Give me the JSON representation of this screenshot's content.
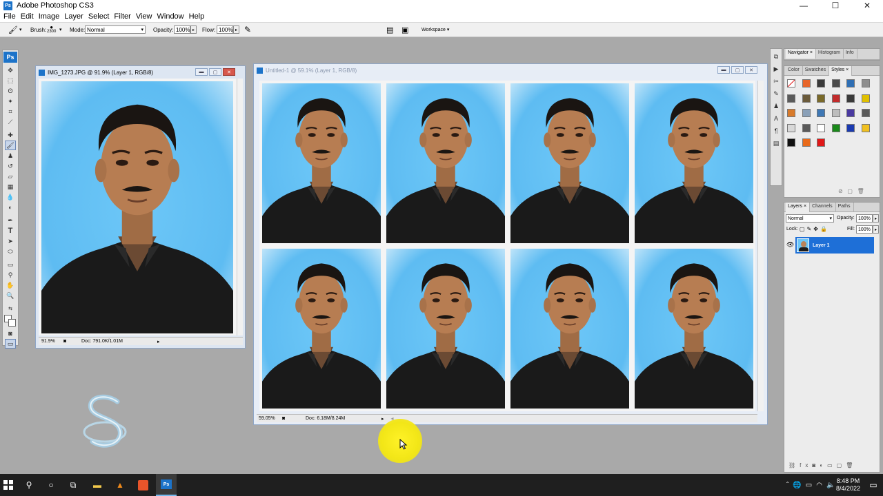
{
  "app": {
    "title": "Adobe Photoshop CS3",
    "logo": "Ps"
  },
  "menu": [
    "File",
    "Edit",
    "Image",
    "Layer",
    "Select",
    "Filter",
    "View",
    "Window",
    "Help"
  ],
  "options": {
    "brush_label": "Brush:",
    "brush_size": "2300",
    "mode_label": "Mode:",
    "mode_value": "Normal",
    "opacity_label": "Opacity:",
    "opacity_value": "100%",
    "flow_label": "Flow:",
    "flow_value": "100%",
    "workspace_label": "Workspace ▾"
  },
  "doc1": {
    "title": "IMG_1273.JPG @ 91.9% (Layer 1, RGB/8)",
    "zoom": "91.9%",
    "doc_size": "Doc: 791.0K/1.01M"
  },
  "doc2": {
    "title": "Untitled-1 @ 59.1% (Layer 1, RGB/8)",
    "zoom": "59.05%",
    "doc_size": "Doc: 6.18M/8.24M"
  },
  "panels": {
    "top_tabs": [
      "Navigator",
      "Histogram",
      "Info"
    ],
    "mid_tabs": [
      "Color",
      "Swatches",
      "Styles"
    ],
    "layers_tabs": [
      "Layers",
      "Channels",
      "Paths"
    ],
    "blend_mode": "Normal",
    "opacity_label": "Opacity:",
    "opacity_value": "100%",
    "lock_label": "Lock:",
    "fill_label": "Fill:",
    "fill_value": "100%",
    "layer_name": "Layer 1"
  },
  "taskbar": {
    "time": "8:48 PM",
    "date": "8/4/2022"
  },
  "colors": {
    "background_blue": "#5ebcf2",
    "selection_blue": "#1e6fd7",
    "workspace_gray": "#a9a9a9",
    "cursor_highlight": "#fff227"
  }
}
